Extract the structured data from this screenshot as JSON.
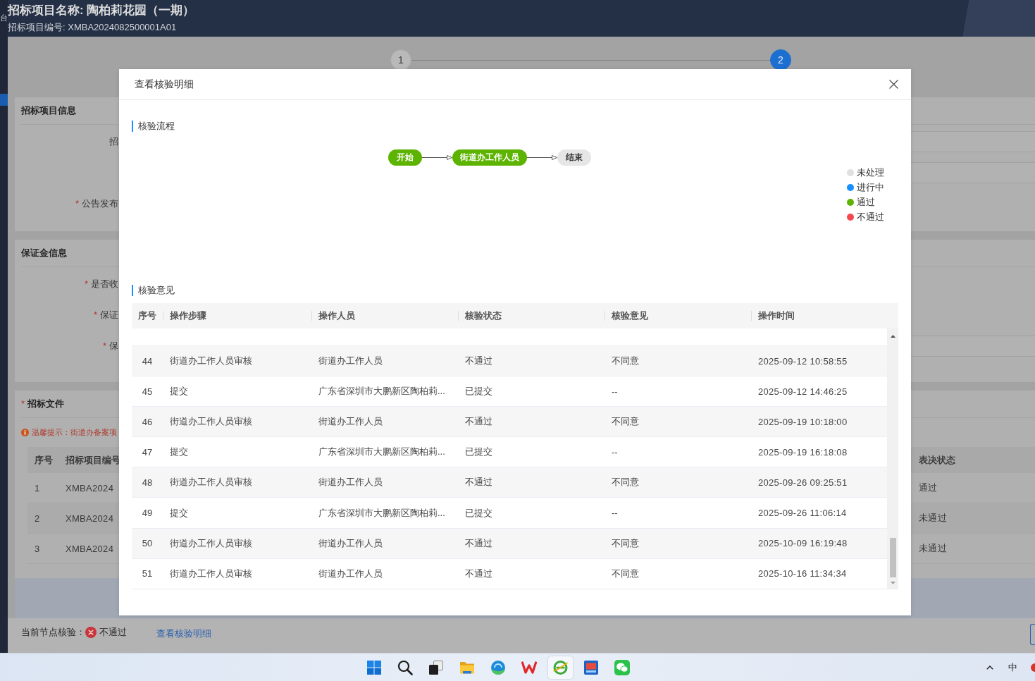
{
  "sidebar": {
    "label": "台"
  },
  "header": {
    "title": "招标项目名称: 陶柏莉花园（一期）",
    "code": "招标项目编号: XMBA2024082500001A01"
  },
  "steps": [
    {
      "label": "1",
      "selected": false
    },
    {
      "label": "2",
      "selected": true
    }
  ],
  "sections": [
    {
      "title": "招标项目信息",
      "fields": [
        {
          "label": "招",
          "kind": "input"
        },
        {
          "kind": "input"
        },
        {
          "label": "公告发布",
          "required_mark": "*",
          "kind": "plain"
        }
      ]
    },
    {
      "title": "保证金信息",
      "fields": [
        {
          "label": "是否收",
          "required_mark": "*",
          "kind": "plain"
        },
        {
          "label": "保证",
          "required_mark": "*",
          "kind": "plain"
        },
        {
          "label": "保",
          "required_mark": "*",
          "kind": "input"
        }
      ]
    },
    {
      "title": "招标文件",
      "required_mark": "*",
      "notice": "温馨提示：街道办备案项",
      "table": {
        "columns": [
          "序号",
          "招标项目编号",
          "表决状态"
        ],
        "rows": [
          [
            "1",
            "XMBA2024",
            "通过"
          ],
          [
            "2",
            "XMBA2024",
            "未通过"
          ],
          [
            "3",
            "XMBA2024",
            "未通过"
          ]
        ]
      }
    }
  ],
  "footer": {
    "label": "当前节点核验：",
    "passed": false,
    "status": "不通过",
    "link": "查看核验明细"
  },
  "taskbar": {
    "apps": [
      {
        "selected": false
      },
      {
        "selected": false
      },
      {
        "selected": false
      },
      {
        "selected": false
      },
      {
        "selected": false
      },
      {
        "selected": false
      },
      {
        "selected": true
      },
      {
        "selected": false
      },
      {
        "selected": false
      }
    ],
    "ime": "中"
  },
  "dialog": {
    "title": "查看核验明细",
    "flow_title": "核验流程",
    "flow": [
      {
        "label": "开始",
        "color": "#5cb300"
      },
      {
        "label": "街道办工作人员",
        "color": "#5cb300"
      },
      {
        "label": "结束",
        "color": "#e6e6e6"
      }
    ],
    "legend": [
      {
        "label": "未处理",
        "color": "#e0e0e0"
      },
      {
        "label": "进行中",
        "color": "#1890ff"
      },
      {
        "label": "通过",
        "color": "#5cb300"
      },
      {
        "label": "不通过",
        "color": "#f5474f"
      }
    ],
    "opinions_title": "核验意见",
    "table": {
      "columns": [
        "序号",
        "操作步骤",
        "操作人员",
        "核验状态",
        "核验意见",
        "操作时间"
      ],
      "rows": [
        [
          "44",
          "街道办工作人员审核",
          "街道办工作人员",
          "不通过",
          "不同意",
          "2025-09-12 10:58:55"
        ],
        [
          "45",
          "提交",
          "广东省深圳市大鹏新区陶柏莉...",
          "已提交",
          "--",
          "2025-09-12 14:46:25"
        ],
        [
          "46",
          "街道办工作人员审核",
          "街道办工作人员",
          "不通过",
          "不同意",
          "2025-09-19 10:18:00"
        ],
        [
          "47",
          "提交",
          "广东省深圳市大鹏新区陶柏莉...",
          "已提交",
          "--",
          "2025-09-19 16:18:08"
        ],
        [
          "48",
          "街道办工作人员审核",
          "街道办工作人员",
          "不通过",
          "不同意",
          "2025-09-26 09:25:51"
        ],
        [
          "49",
          "提交",
          "广东省深圳市大鹏新区陶柏莉...",
          "已提交",
          "--",
          "2025-09-26 11:06:14"
        ],
        [
          "50",
          "街道办工作人员审核",
          "街道办工作人员",
          "不通过",
          "不同意",
          "2025-10-09 16:19:48"
        ],
        [
          "51",
          "街道办工作人员审核",
          "街道办工作人员",
          "不通过",
          "不同意",
          "2025-10-16 11:34:34"
        ]
      ]
    }
  }
}
